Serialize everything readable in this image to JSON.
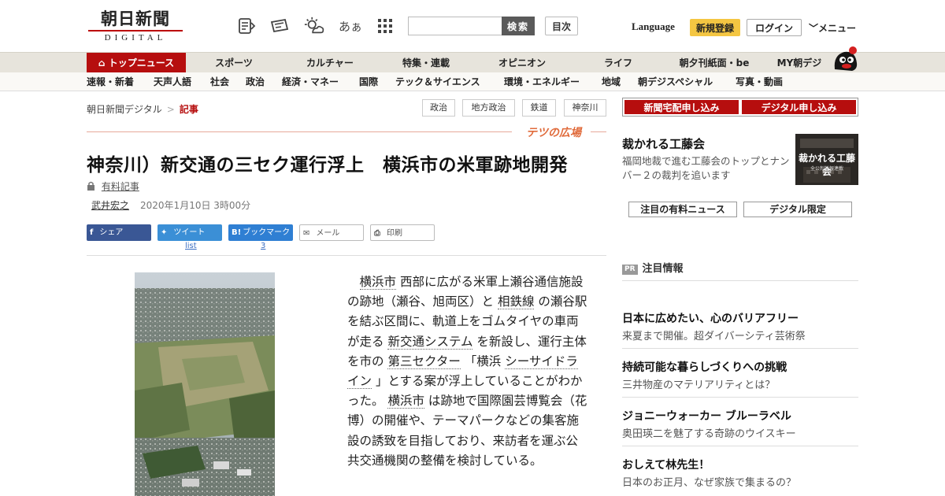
{
  "header": {
    "logo_main": "朝日新聞",
    "logo_sub": "DIGITAL",
    "icons": [
      "paper-icon",
      "scrap-icon",
      "weather-icon",
      "font-size-icon",
      "grid-menu-icon"
    ],
    "font_icon_text": "あぁ",
    "search": {
      "placeholder": "",
      "button": "検索"
    },
    "toc": "目次",
    "language": "Language",
    "register": "新規登録",
    "login": "ログイン",
    "menu": "メニュー"
  },
  "mainnav": [
    "トップニュース",
    "スポーツ",
    "カルチャー",
    "特集・連載",
    "オピニオン",
    "ライフ",
    "朝夕刊紙面・be",
    "MY朝デジ"
  ],
  "subnav": [
    "速報・新着",
    "天声人語",
    "社会",
    "政治",
    "経済・マネー",
    "国際",
    "テック＆サイエンス",
    "環境・エネルギー",
    "地域",
    "朝デジスペシャル",
    "写真・動画"
  ],
  "breadcrumb": {
    "home": "朝日新聞デジタル",
    "current": "記事"
  },
  "tags": [
    "政治",
    "地方政治",
    "鉄道",
    "神奈川"
  ],
  "section_label": "テツの広場",
  "article": {
    "headline": "神奈川）新交通の三セク運行浮上　横浜市の米軍跡地開発",
    "paid_label": "有料記事",
    "author": "武井宏之",
    "date": "2020年1月10日 3時00分",
    "body": [
      {
        "t": "　"
      },
      {
        "t": "横浜市",
        "k": 1
      },
      {
        "t": " 西部に広がる米軍上瀬谷通信施設の跡地（瀬谷、旭両区）と "
      },
      {
        "t": "相鉄線",
        "k": 1
      },
      {
        "t": " の瀬谷駅を結ぶ区間に、軌道上をゴムタイヤの車両が走る "
      },
      {
        "t": "新交通システム",
        "k": 1
      },
      {
        "t": " を新設し、運行主体を市の "
      },
      {
        "t": "第三セクター",
        "k": 1
      },
      {
        "t": " 「横浜 "
      },
      {
        "t": "シーサイドライン",
        "k": 1
      },
      {
        "t": " 」とする案が浮上していることがわかった。 "
      },
      {
        "t": "横浜市",
        "k": 1
      },
      {
        "t": " は跡地で国際園芸博覧会（花博）の開催や、テーマパークなどの集客施設の誘致を目指しており、来訪者を運ぶ公共交通機関の整備を検討している。"
      }
    ]
  },
  "share": {
    "facebook": "シェア",
    "twitter": "ツイート",
    "twitter_count": "list",
    "hatena": "ブックマーク",
    "hatena_count": "3",
    "mail": "メール",
    "print": "印刷"
  },
  "sidebar": {
    "cta_home": "新聞宅配申し込み",
    "cta_digital": "デジタル申し込み",
    "feature": {
      "title": "裁かれる工藤会",
      "desc": "福岡地裁で進む工藤会のトップとナンバー２の裁判を追います",
      "img_title": "裁かれる工藤会",
      "img_sub": "全公判詳報連載"
    },
    "pill_paid": "注目の有料ニュース",
    "pill_digital": "デジタル限定",
    "pr_badge": "PR",
    "pr_heading": "注目情報",
    "pr_items": [
      {
        "title": "日本に広めたい、心のバリアフリー",
        "sub": "来夏まで開催。超ダイバーシティ芸術祭"
      },
      {
        "title": "持続可能な暮らしづくりへの挑戦",
        "sub": "三井物産のマテリアリティとは？"
      },
      {
        "title": "ジョニーウォーカー ブルーラベル",
        "sub": "奥田瑛二を魅了する奇跡のウイスキー"
      },
      {
        "title": "おしえて林先生！",
        "sub": "日本のお正月、なぜ家族で集まるの？"
      }
    ]
  },
  "colors": {
    "brand_red": "#b60e0e",
    "accent_orange": "#e06a3a",
    "link_blue": "#3b6ec2",
    "register_yellow": "#f4c642"
  }
}
